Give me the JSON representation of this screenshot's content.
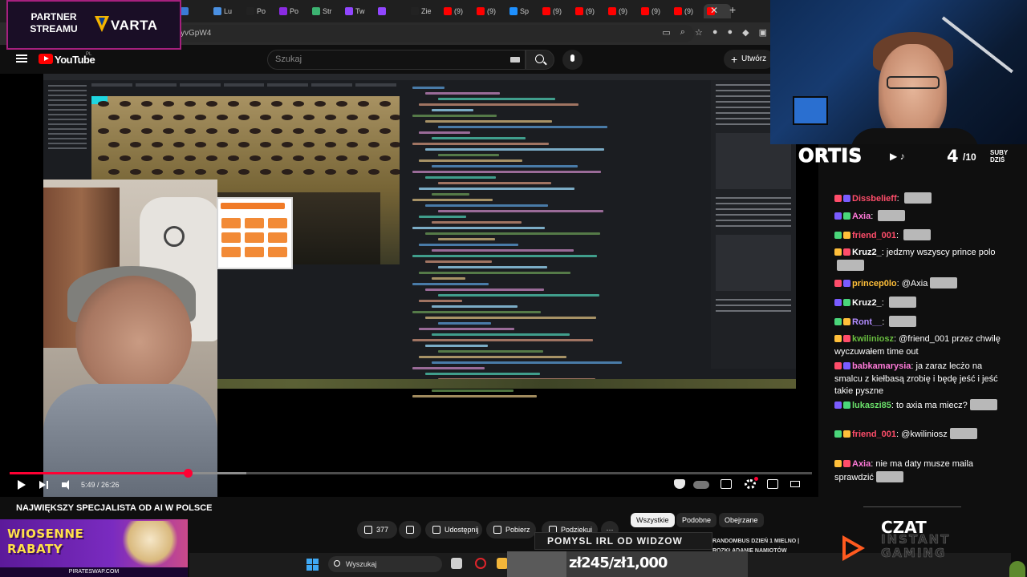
{
  "browser": {
    "tabs": [
      {
        "label": "",
        "color": "#3a7bd5"
      },
      {
        "label": "Lu",
        "color": "#4a90e2"
      },
      {
        "label": "Po",
        "color": "#222222"
      },
      {
        "label": "Po",
        "color": "#8a2be2"
      },
      {
        "label": "Str",
        "color": "#3cb371"
      },
      {
        "label": "Tw",
        "color": "#9146ff"
      },
      {
        "label": "",
        "color": "#9146ff"
      },
      {
        "label": "Zie",
        "color": "#222222"
      },
      {
        "label": "(9)",
        "color": "#ff0000"
      },
      {
        "label": "(9)",
        "color": "#ff0000"
      },
      {
        "label": "Sp",
        "color": "#1e90ff"
      },
      {
        "label": "(9)",
        "color": "#ff0000"
      },
      {
        "label": "(9)",
        "color": "#ff0000"
      },
      {
        "label": "(9)",
        "color": "#ff0000"
      },
      {
        "label": "(9)",
        "color": "#ff0000"
      },
      {
        "label": "(9)",
        "color": "#ff0000"
      },
      {
        "label": "",
        "color": "#ff0000"
      }
    ],
    "url": "yvGpW4"
  },
  "youtube": {
    "logo_text": "YouTube",
    "region": "PL",
    "search_placeholder": "Szukaj",
    "create_label": "Utwórz"
  },
  "player": {
    "time": "5:49 / 26:26",
    "progress": 0.222,
    "buffered": 0.295
  },
  "video": {
    "title": "NAJWIĘKSZY SPECJALISTA OD AI W POLSCE",
    "likes": "377",
    "share_label": "Udostępnij",
    "download_label": "Pobierz",
    "thanks_label": "Podziękuj",
    "more_label": "···"
  },
  "chips": {
    "all": "Wszystkie",
    "similar": "Podobne",
    "related": "Obejrzane"
  },
  "taskbar": {
    "search_placeholder": "Wyszukaj"
  },
  "overlay": {
    "partner_label": "PARTNER STREAMU",
    "partner_brand": "VARTA",
    "promo_line1": "WIOSENNE",
    "promo_line2": "RABATY",
    "promo_url": "PIRATESWAP.COM",
    "streamer_name": "ORTIS",
    "subs_current": "4",
    "subs_total": "/10",
    "subs_label": "SUBY DZIŚ",
    "czat_title": "CZAT",
    "czat_sub1": "INSTANT",
    "czat_sub2": "GAMING",
    "ticker_line1": "RANDOMBUS DZIEŃ 1 MIELNO |",
    "ticker_line2": "ROZKŁADANIE NAMIOTÓW",
    "pomysl_label": "POMYSL IRL OD WIDZOW",
    "goal_text": "zł245/zł1,000",
    "goal_progress": 0.245
  },
  "chat": [
    {
      "user": "Dissbelieff",
      "color": "#ff4d6a",
      "text": "",
      "emote": true
    },
    {
      "user": "Axia",
      "color": "#ff7ad9",
      "text": "",
      "emote": true
    },
    {
      "user": "friend_001",
      "color": "#ff4d6a",
      "text": "",
      "emote": true
    },
    {
      "user": "Kruz2_",
      "color": "#ffffff",
      "text": "jedzmy wszyscy prince polo",
      "emote": true
    },
    {
      "user": "princep0lo",
      "color": "#ffbf3a",
      "text": "@Axia",
      "emote": true
    },
    {
      "user": "Kruz2_",
      "color": "#ffffff",
      "text": "",
      "emote": true
    },
    {
      "user": "Ront__",
      "color": "#b28cff",
      "text": "",
      "emote": true
    },
    {
      "user": "kwiliniosz",
      "color": "#6abf40",
      "text": "@friend_001 przez chwilę wyczuwałem time out",
      "emote": false
    },
    {
      "user": "babkamarysia",
      "color": "#ff7ad9",
      "text": "ja zaraz lecżo na smalcu z kiełbasą zrobię i będę jeść i jeść takie pyszne",
      "emote": false
    },
    {
      "user": "lukaszi85",
      "color": "#6adf6a",
      "text": "to axia ma miecz?",
      "emote": true
    },
    {
      "user": "friend_001",
      "color": "#ff4d6a",
      "text": "@kwiliniosz",
      "emote": true
    },
    {
      "user": "Axia",
      "color": "#ff7ad9",
      "text": "nie ma daty musze maila sprawdzić",
      "emote": true
    }
  ]
}
